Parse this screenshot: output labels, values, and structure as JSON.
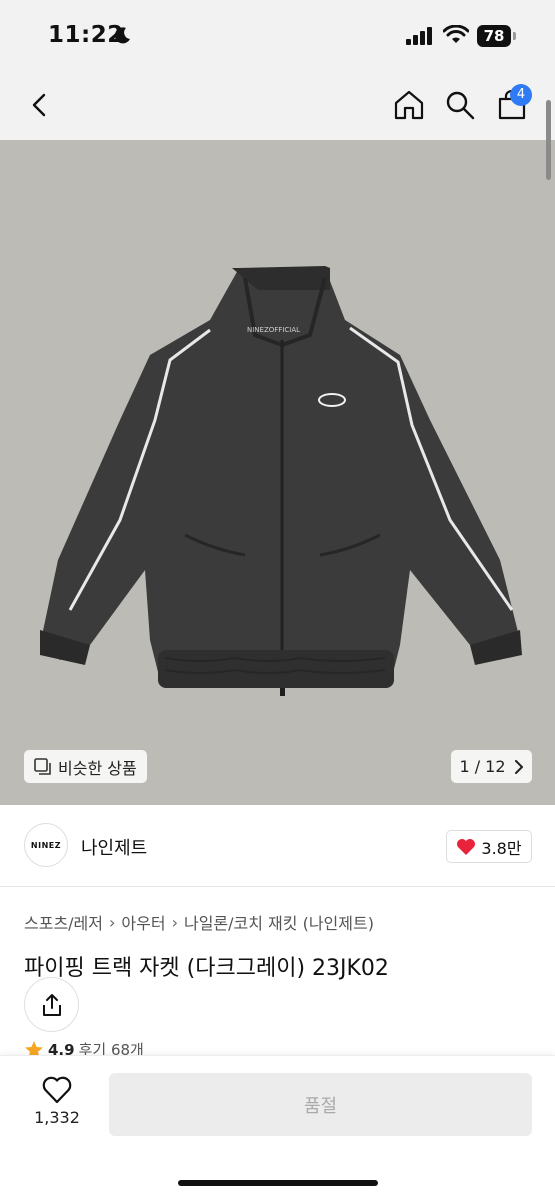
{
  "status_bar": {
    "time": "11:22",
    "battery": "78"
  },
  "nav": {
    "cart_count": "4"
  },
  "hero": {
    "jacket_print": "NINEZOFFICIAL",
    "similar_label": "비슷한 상품",
    "pager": "1 / 12"
  },
  "brand": {
    "logo_text": "NINEZ",
    "name": "나인제트",
    "likes": "3.8만"
  },
  "breadcrumb": [
    "스포츠/레저",
    "아우터",
    "나일론/코치 재킷 (나인제트)"
  ],
  "product": {
    "title": "파이핑 트랙 자켓 (다크그레이) 23JK02",
    "rating": "4.9",
    "reviews": "후기 68개"
  },
  "bottom": {
    "wish_count": "1,332",
    "buy_label": "품절"
  },
  "colors": {
    "accent": "#2f7bf5",
    "heart": "#e8233b",
    "star": "#f5a623",
    "hero_bg": "#bdbbb6"
  }
}
